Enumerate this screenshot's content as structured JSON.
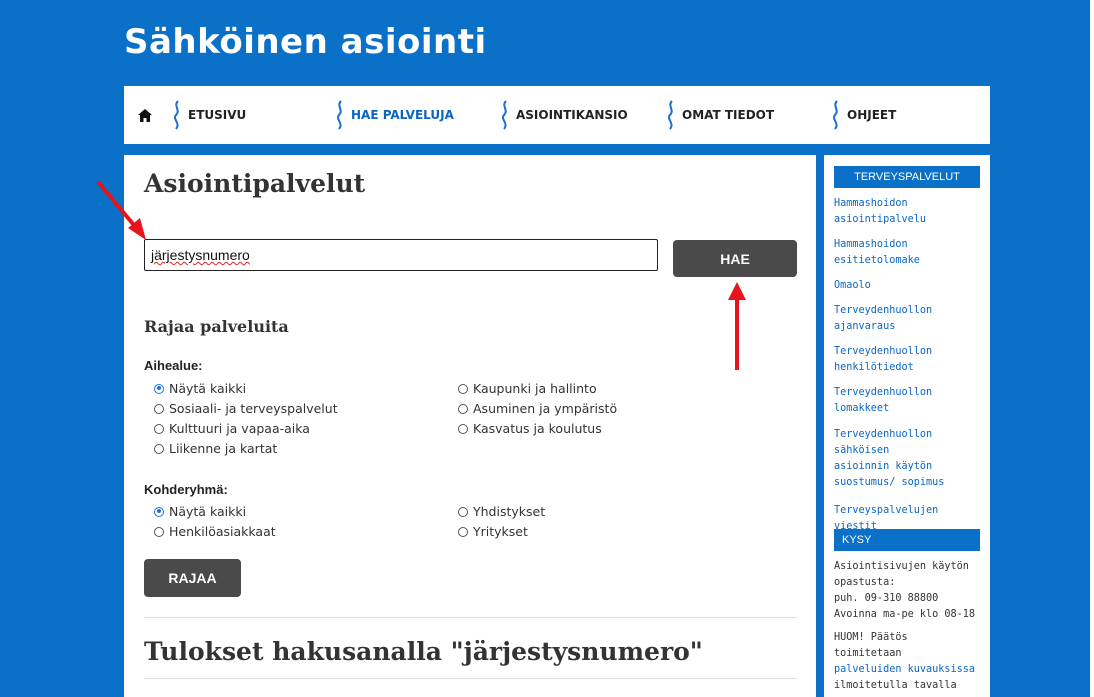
{
  "site": {
    "title": "Sähköinen asiointi"
  },
  "nav": {
    "items": [
      {
        "label": "ETUSIVU"
      },
      {
        "label": "HAE PALVELUJA"
      },
      {
        "label": "ASIOINTIKANSIO"
      },
      {
        "label": "OMAT TIEDOT"
      },
      {
        "label": "OHJEET"
      }
    ]
  },
  "main": {
    "title": "Asiointipalvelut",
    "search": {
      "value": "järjestysnumero",
      "button_label": "HAE"
    },
    "filter": {
      "heading": "Rajaa palveluita",
      "topic_label": "Aihealue:",
      "topic_options": [
        "Näytä kaikki",
        "Sosiaali- ja terveyspalvelut",
        "Kulttuuri ja vapaa-aika",
        "Liikenne ja kartat",
        "Kaupunki ja hallinto",
        "Asuminen ja ympäristö",
        "Kasvatus ja koulutus"
      ],
      "topic_selected": "Näytä kaikki",
      "audience_label": "Kohderyhmä:",
      "audience_options": [
        "Näytä kaikki",
        "Henkilöasiakkaat",
        "Yhdistykset",
        "Yritykset"
      ],
      "audience_selected": "Näytä kaikki",
      "button_label": "RAJAA"
    },
    "results_heading": "Tulokset hakusanalla \"järjestysnumero\""
  },
  "sidebar": {
    "health_heading": "TERVEYSPALVELUT",
    "links": [
      "Hammashoidon\nasiointipalvelu",
      "Hammashoidon\nesitietolomake",
      "Omaolo",
      "Terveydenhuollon\najanvaraus",
      "Terveydenhuollon\nhenkilötiedot",
      "Terveydenhuollon\nlomakkeet",
      "Terveydenhuollon\nsähköisen\nasioinnin käytön\nsuostumus/ sopimus",
      "Terveyspalvelujen viestit"
    ],
    "ask_heading": "KYSY",
    "ask_text": "Asiointisivujen käytön\nopastusta:\npuh. 09-310 88800\nAvoinna ma-pe klo 08-18",
    "notice_text": "HUOM! Päätös\ntoimitetaan",
    "notice_link": "palveluiden kuvauksissa",
    "notice_text2": "ilmoitetulla tavalla"
  },
  "colors": {
    "brand": "#0a70c8",
    "button": "#4a4a4a",
    "arrow": "#e8141c",
    "link": "#0a66c2"
  },
  "icons": {
    "home": "home-icon",
    "nav_separator": "wave-icon"
  }
}
